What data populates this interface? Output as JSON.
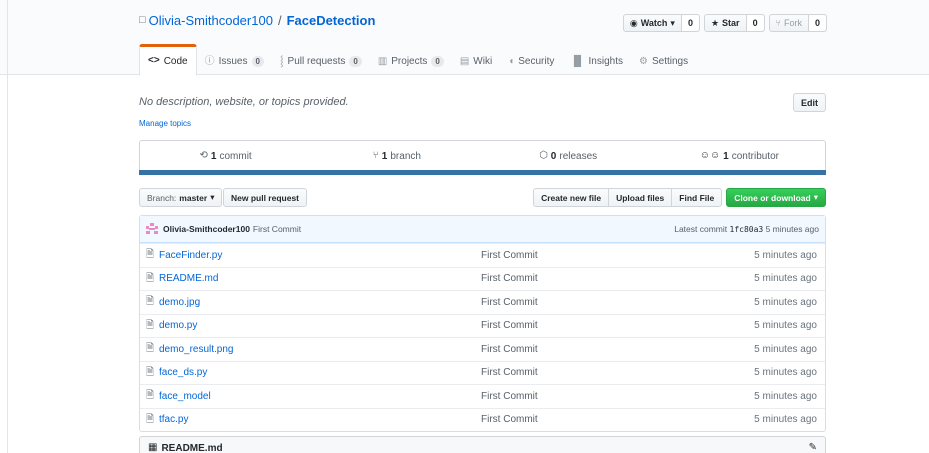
{
  "repo": {
    "owner": "Olivia-Smithcoder100",
    "separator": "/",
    "name": "FaceDetection"
  },
  "actions": {
    "watch": {
      "label": "Watch",
      "count": "0"
    },
    "star": {
      "label": "Star",
      "count": "0"
    },
    "fork": {
      "label": "Fork",
      "count": "0"
    }
  },
  "tabs": [
    {
      "label": "Code",
      "icon": "code-icon"
    },
    {
      "label": "Issues",
      "count": "0",
      "icon": "issue-icon"
    },
    {
      "label": "Pull requests",
      "count": "0",
      "icon": "pull-request-icon"
    },
    {
      "label": "Projects",
      "count": "0",
      "icon": "project-icon"
    },
    {
      "label": "Wiki",
      "icon": "wiki-icon"
    },
    {
      "label": "Security",
      "icon": "shield-icon"
    },
    {
      "label": "Insights",
      "icon": "graph-icon"
    },
    {
      "label": "Settings",
      "icon": "gear-icon"
    }
  ],
  "description": {
    "text": "No description, website, or topics provided.",
    "manage_topics": "Manage topics",
    "edit": "Edit"
  },
  "summary": {
    "commits": {
      "num": "1",
      "label": "commit"
    },
    "branches": {
      "num": "1",
      "label": "branch"
    },
    "releases": {
      "num": "0",
      "label": "releases"
    },
    "contributors": {
      "num": "1",
      "label": "contributor"
    }
  },
  "file_nav": {
    "branch_label": "Branch:",
    "branch_value": "master",
    "new_pr": "New pull request",
    "create_file": "Create new file",
    "upload_files": "Upload files",
    "find_file": "Find File",
    "clone": "Clone or download"
  },
  "commit_tease": {
    "author": "Olivia-Smithcoder100",
    "message": "First Commit",
    "latest_label": "Latest commit",
    "sha": "1fc80a3",
    "age": "5 minutes ago"
  },
  "files": [
    {
      "name": "FaceFinder.py",
      "message": "First Commit",
      "age": "5 minutes ago"
    },
    {
      "name": "README.md",
      "message": "First Commit",
      "age": "5 minutes ago"
    },
    {
      "name": "demo.jpg",
      "message": "First Commit",
      "age": "5 minutes ago"
    },
    {
      "name": "demo.py",
      "message": "First Commit",
      "age": "5 minutes ago"
    },
    {
      "name": "demo_result.png",
      "message": "First Commit",
      "age": "5 minutes ago"
    },
    {
      "name": "face_ds.py",
      "message": "First Commit",
      "age": "5 minutes ago"
    },
    {
      "name": "face_model",
      "message": "First Commit",
      "age": "5 minutes ago"
    },
    {
      "name": "tfac.py",
      "message": "First Commit",
      "age": "5 minutes ago"
    }
  ],
  "readme": {
    "title": "README.md"
  },
  "colors": {
    "link": "#0366d6",
    "tab_accent": "#e36209",
    "language_bar": "#3572a5",
    "primary_button": "#28a745"
  }
}
